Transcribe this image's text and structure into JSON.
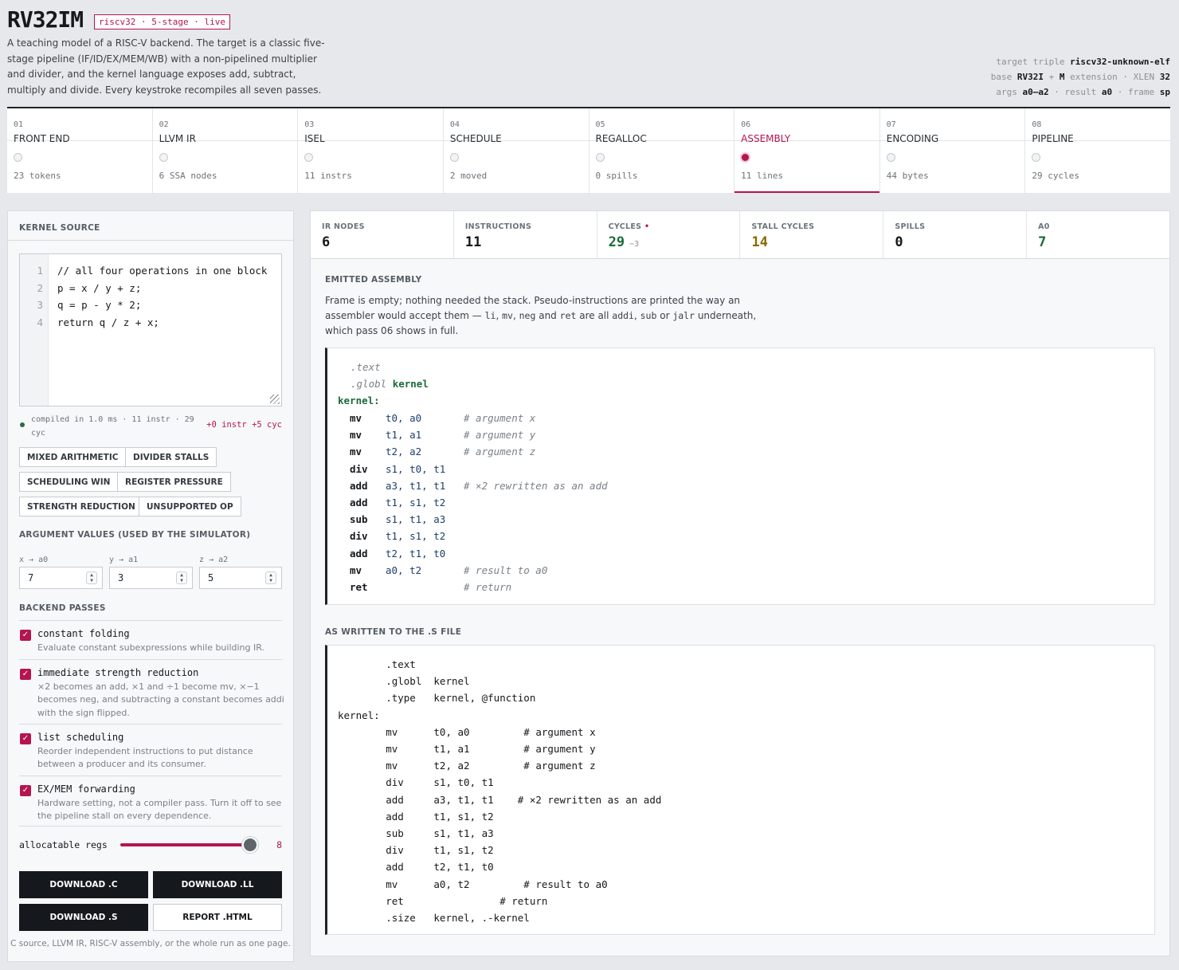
{
  "header": {
    "title": "RV32IM",
    "badge": "riscv32 · 5-stage · live",
    "description": "A teaching model of a RISC-V backend. The target is a classic five-stage pipeline (IF/ID/EX/MEM/WB) with a non-pipelined multiplier and divider, and the kernel language exposes add, subtract, multiply and divide. Every keystroke recompiles all seven passes.",
    "meta": {
      "triple_label": "target triple",
      "triple": "riscv32-unknown-elf",
      "base_label": "base",
      "base": "RV32I",
      "plus": "+",
      "ext": "M",
      "ext_label": "extension",
      "xlen_label": "XLEN",
      "xlen": "32",
      "args_label": "args",
      "args": "a0–a2",
      "result_label": "result",
      "result": "a0",
      "frame_label": "frame",
      "frame": "sp",
      "sep": "·"
    }
  },
  "stages": [
    {
      "num": "01",
      "label": "FRONT END",
      "stat": "23 tokens"
    },
    {
      "num": "02",
      "label": "LLVM IR",
      "stat": "6 SSA nodes"
    },
    {
      "num": "03",
      "label": "ISEL",
      "stat": "11 instrs"
    },
    {
      "num": "04",
      "label": "SCHEDULE",
      "stat": "2 moved"
    },
    {
      "num": "05",
      "label": "REGALLOC",
      "stat": "0 spills"
    },
    {
      "num": "06",
      "label": "ASSEMBLY",
      "stat": "11 lines",
      "active": true
    },
    {
      "num": "07",
      "label": "ENCODING",
      "stat": "44 bytes"
    },
    {
      "num": "08",
      "label": "PIPELINE",
      "stat": "29 cycles"
    }
  ],
  "kernel": {
    "title": "KERNEL SOURCE",
    "lines": [
      "// all four operations in one block",
      "p = x / y + z;",
      "q = p - y * 2;",
      "return q / z + x;"
    ],
    "line_numbers": [
      "1",
      "2",
      "3",
      "4"
    ],
    "compiled": "compiled in 1.0 ms · 11 instr · 29 cyc",
    "delta": "+0 instr +5 cyc",
    "presets": [
      "MIXED ARITHMETIC",
      "DIVIDER STALLS",
      "SCHEDULING WIN",
      "REGISTER PRESSURE",
      "STRENGTH REDUCTION",
      "UNSUPPORTED OP"
    ]
  },
  "args": {
    "title": "ARGUMENT VALUES (USED BY THE SIMULATOR)",
    "items": [
      {
        "label": "x → a0",
        "value": "7"
      },
      {
        "label": "y → a1",
        "value": "3"
      },
      {
        "label": "z → a2",
        "value": "5"
      }
    ]
  },
  "passes": {
    "title": "BACKEND PASSES",
    "items": [
      {
        "name": "constant folding",
        "desc": "Evaluate constant subexpressions while building IR.",
        "checked": true
      },
      {
        "name": "immediate strength reduction",
        "desc": "×2 becomes an add, ×1 and ÷1 become mv, ×−1 becomes neg, and subtracting a constant becomes addi with the sign flipped.",
        "checked": true
      },
      {
        "name": "list scheduling",
        "desc": "Reorder independent instructions to put distance between a producer and its consumer.",
        "checked": true
      },
      {
        "name": "EX/MEM forwarding",
        "desc": "Hardware setting, not a compiler pass. Turn it off to see the pipeline stall on every dependence.",
        "checked": true
      }
    ]
  },
  "regs": {
    "label": "allocatable regs",
    "value": "8"
  },
  "downloads": {
    "c": "DOWNLOAD .C",
    "ll": "DOWNLOAD .LL",
    "s": "DOWNLOAD .S",
    "report": "REPORT .HTML",
    "note": "C source, LLVM IR, RISC-V assembly, or the whole run as one page."
  },
  "metrics": [
    {
      "label": "IR NODES",
      "value": "6"
    },
    {
      "label": "INSTRUCTIONS",
      "value": "11"
    },
    {
      "label": "CYCLES",
      "value": "29",
      "star": "•",
      "delta": "−3",
      "color": "#1c6b3a"
    },
    {
      "label": "STALL CYCLES",
      "value": "14",
      "color": "#8a6a00"
    },
    {
      "label": "SPILLS",
      "value": "0"
    },
    {
      "label": "A0",
      "value": "7",
      "color": "#1c6b3a"
    }
  ],
  "emitted": {
    "title": "EMITTED ASSEMBLY",
    "desc": {
      "p1": "Frame is empty; nothing needed the stack. Pseudo-instructions are printed the way an assembler would accept them — ",
      "li": "li",
      "c1": ", ",
      "mv": "mv",
      "c2": ", ",
      "neg": "neg",
      "and": " and ",
      "ret": "ret",
      "p2": " are all ",
      "addi": "addi",
      "c3": ", ",
      "sub": "sub",
      "or": " or ",
      "jalr": "jalr",
      "p3": " underneath, which pass 06 shows in full."
    },
    "directives": [
      ".text",
      ".globl"
    ],
    "globl_sym": "kernel",
    "label": "kernel:",
    "rows": [
      {
        "op": "mv",
        "args": "t0, a0",
        "cmt": "# argument x"
      },
      {
        "op": "mv",
        "args": "t1, a1",
        "cmt": "# argument y"
      },
      {
        "op": "mv",
        "args": "t2, a2",
        "cmt": "# argument z"
      },
      {
        "op": "div",
        "args": "s1, t0, t1",
        "cmt": ""
      },
      {
        "op": "add",
        "args": "a3, t1, t1",
        "cmt": "# ×2 rewritten as an add"
      },
      {
        "op": "add",
        "args": "t1, s1, t2",
        "cmt": ""
      },
      {
        "op": "sub",
        "args": "s1, t1, a3",
        "cmt": ""
      },
      {
        "op": "div",
        "args": "t1, s1, t2",
        "cmt": ""
      },
      {
        "op": "add",
        "args": "t2, t1, t0",
        "cmt": ""
      },
      {
        "op": "mv",
        "args": "a0, t2",
        "cmt": "# result to a0"
      },
      {
        "op": "ret",
        "args": "",
        "cmt": "# return"
      }
    ]
  },
  "sfile": {
    "title": "AS WRITTEN TO THE .S FILE",
    "lines": [
      "        .text",
      "        .globl  kernel",
      "        .type   kernel, @function",
      "kernel:",
      "        mv      t0, a0         # argument x",
      "        mv      t1, a1         # argument y",
      "        mv      t2, a2         # argument z",
      "        div     s1, t0, t1",
      "        add     a3, t1, t1    # ×2 rewritten as an add",
      "        add     t1, s1, t2",
      "        sub     s1, t1, a3",
      "        div     t1, s1, t2",
      "        add     t2, t1, t0",
      "        mv      a0, t2         # result to a0",
      "        ret                # return",
      "        .size   kernel, .-kernel"
    ]
  }
}
